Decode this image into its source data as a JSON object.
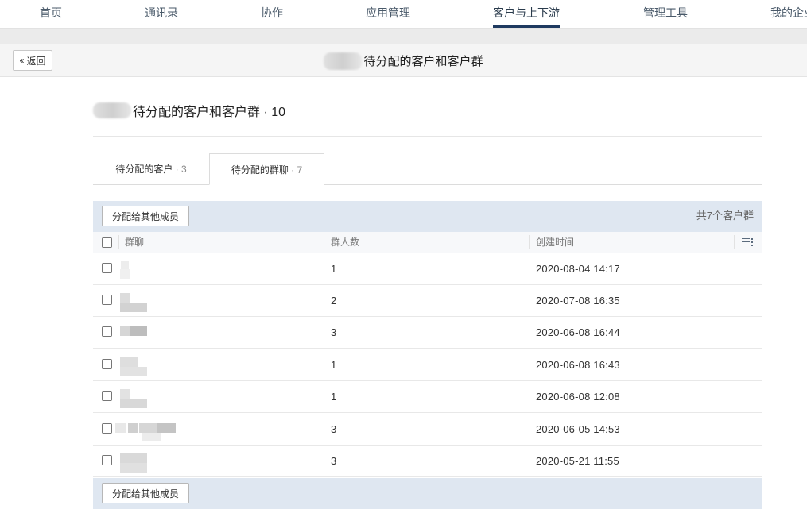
{
  "nav": {
    "items": [
      {
        "label": "首页"
      },
      {
        "label": "通讯录"
      },
      {
        "label": "协作"
      },
      {
        "label": "应用管理"
      },
      {
        "label": "客户与上下游"
      },
      {
        "label": "管理工具"
      },
      {
        "label": "我的企业"
      }
    ],
    "active_index": 4
  },
  "header": {
    "back_label": "返回",
    "title": "待分配的客户和客户群"
  },
  "section": {
    "title": "待分配的客户和客户群 · 10"
  },
  "tabs": [
    {
      "label": "待分配的客户",
      "count": " · 3"
    },
    {
      "label": "待分配的群聊",
      "count": " · 7",
      "active": true
    }
  ],
  "toolbar": {
    "assign_label": "分配给其他成员",
    "total_text": "共7个客户群"
  },
  "table": {
    "columns": [
      "群聊",
      "群人数",
      "创建时间"
    ],
    "rows": [
      {
        "member_count": "1",
        "created": "2020-08-04 14:17"
      },
      {
        "member_count": "2",
        "created": "2020-07-08 16:35"
      },
      {
        "member_count": "3",
        "created": "2020-06-08 16:44"
      },
      {
        "member_count": "1",
        "created": "2020-06-08 16:43"
      },
      {
        "member_count": "1",
        "created": "2020-06-08 12:08"
      },
      {
        "member_count": "3",
        "created": "2020-06-05 14:53"
      },
      {
        "member_count": "3",
        "created": "2020-05-21 11:55"
      }
    ]
  },
  "footer": {
    "assign_label": "分配给其他成员"
  },
  "colors": {
    "nav_active_underline": "#1f3a60",
    "toolbar_bg": "#dfe7f1"
  },
  "icons": {
    "back": "double-chevron-left-icon",
    "columns": "column-settings-icon"
  }
}
